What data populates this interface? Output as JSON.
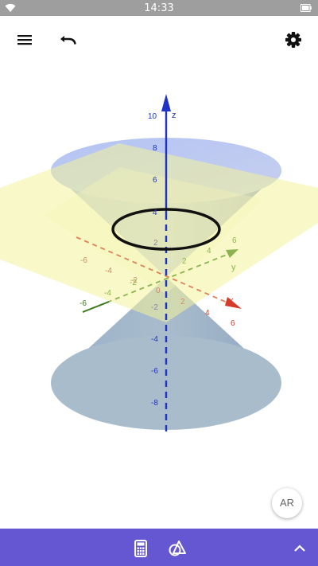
{
  "status_bar": {
    "time": "14:33"
  },
  "colors": {
    "status_bar": "#9e9e9e",
    "bottom_bar": "#6557d2",
    "z_axis": "#1f33c4",
    "x_axis": "#d63a2a",
    "y_axis": "#5a9a2a",
    "cone": "#9fb2dc",
    "plane": "#f2f2a0",
    "ellipse": "#111111"
  },
  "toolbar": {
    "menu_icon": "menu-icon",
    "undo_icon": "undo-icon",
    "settings_icon": "gear-icon"
  },
  "graph": {
    "z_axis_label": "z",
    "x_axis_label": "x",
    "y_axis_label": "y",
    "z_ticks": [
      "10",
      "8",
      "6",
      "4",
      "2",
      "-2",
      "-4",
      "-6",
      "-8"
    ],
    "origin_label": "0",
    "x_ticks": [
      "-6",
      "-4",
      "-2",
      "2",
      "4",
      "6"
    ],
    "y_ticks": [
      "-6",
      "-4",
      "-2",
      "2",
      "4",
      "6"
    ]
  },
  "ar_button": {
    "label": "AR"
  },
  "bottom_bar": {
    "calculator_icon": "calculator-icon",
    "tools_icon": "geometry-tools-icon",
    "expand_icon": "chevron-up-icon"
  }
}
